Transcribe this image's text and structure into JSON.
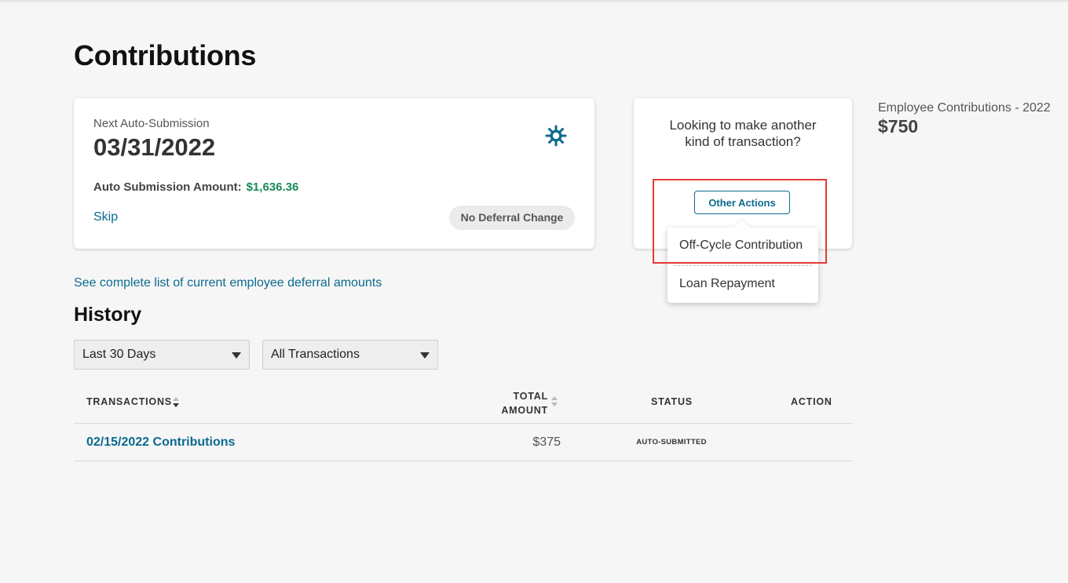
{
  "page": {
    "title": "Contributions"
  },
  "submission_card": {
    "next_label": "Next Auto-Submission",
    "next_date": "03/31/2022",
    "amount_label": "Auto Submission Amount:",
    "amount_value": "$1,636.36",
    "skip_label": "Skip",
    "deferral_badge": "No Deferral Change",
    "settings_icon": "gear-icon"
  },
  "actions_card": {
    "question_line1": "Looking to make another",
    "question_line2": "kind of transaction?",
    "button_label": "Other Actions",
    "menu_items": [
      {
        "label": "Off-Cycle Contribution"
      },
      {
        "label": "Loan Repayment"
      }
    ]
  },
  "summary": {
    "label": "Employee Contributions - 2022",
    "value": "$750"
  },
  "deferral_link": "See complete list of current employee deferral amounts",
  "history": {
    "title": "History",
    "filters": {
      "range": {
        "selected": "Last 30 Days"
      },
      "type": {
        "selected": "All Transactions"
      }
    },
    "columns": {
      "transactions": "TRANSACTIONS",
      "amount_line1": "TOTAL",
      "amount_line2": "AMOUNT",
      "status": "STATUS",
      "action": "ACTION"
    },
    "rows": [
      {
        "name": "02/15/2022 Contributions",
        "amount": "$375",
        "status": "AUTO-SUBMITTED",
        "action": ""
      }
    ]
  },
  "colors": {
    "link": "#0c6a8e",
    "positive_amount": "#1a8a5a",
    "highlight": "#e53935"
  }
}
